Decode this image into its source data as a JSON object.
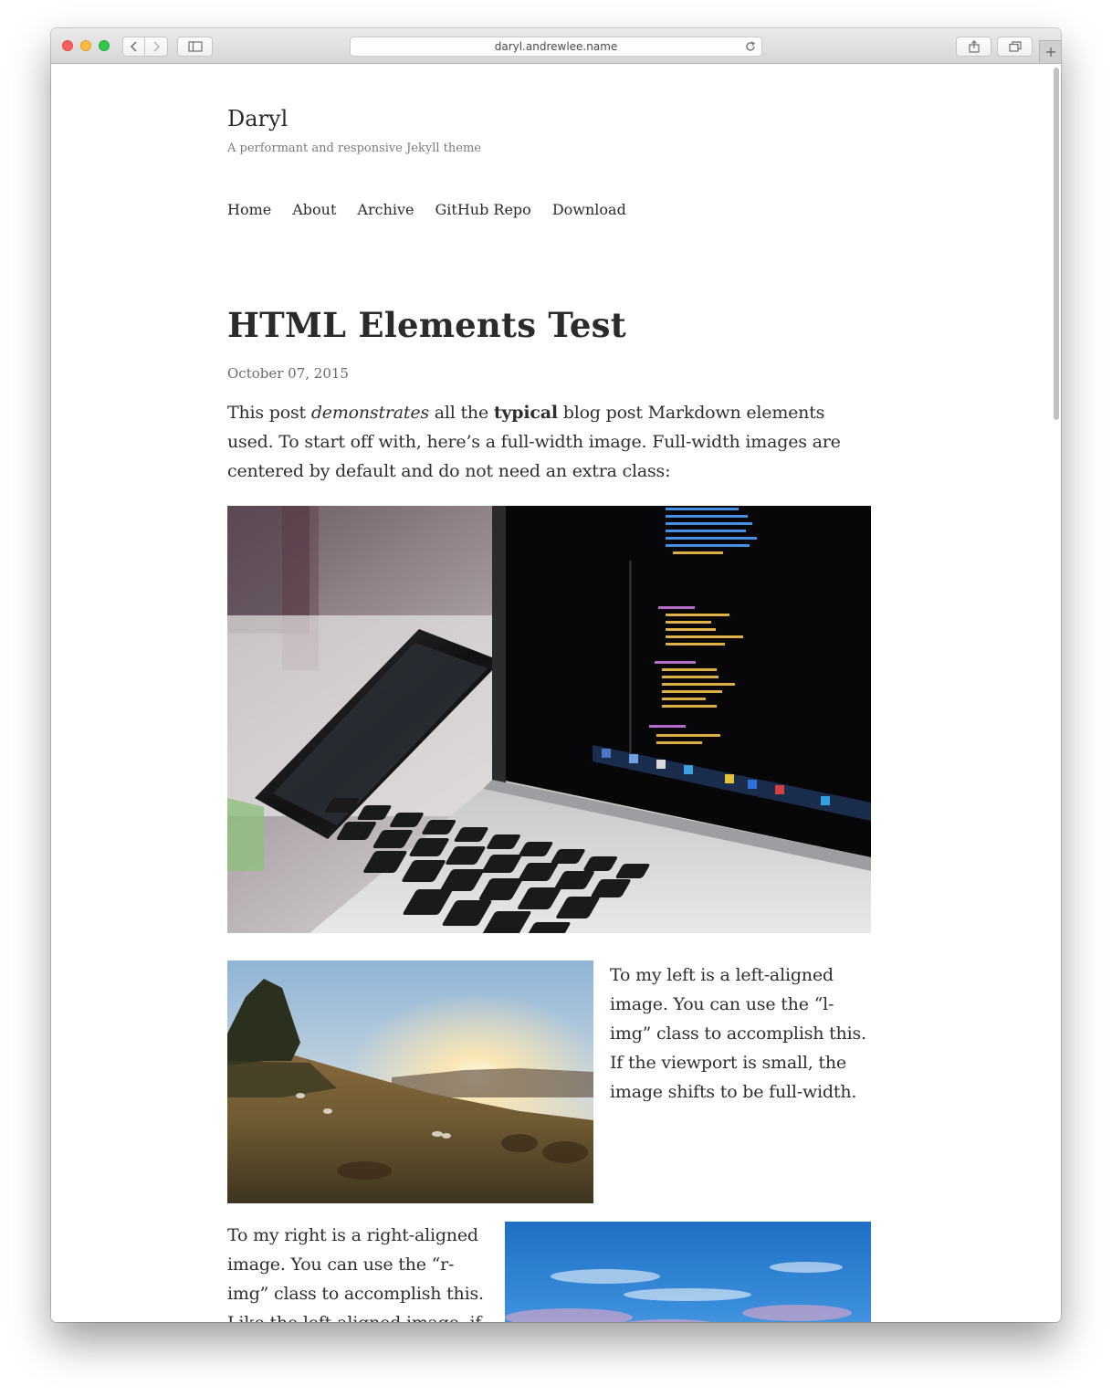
{
  "browser": {
    "url": "daryl.andrewlee.name"
  },
  "site": {
    "title": "Daryl",
    "tagline": "A performant and responsive Jekyll theme",
    "nav": [
      "Home",
      "About",
      "Archive",
      "GitHub Repo",
      "Download"
    ]
  },
  "post": {
    "title": "HTML Elements Test",
    "date": "October 07, 2015",
    "intro": {
      "before_em": "This post ",
      "em": "demonstrates",
      "between": " all the ",
      "strong": "typical",
      "after": " blog post Markdown elements used. To start off with, here’s a full-width image. Full-width images are centered by default and do not need an extra class:"
    },
    "left_text": "To my left is a left-aligned image. You can use the “l-img” class to accomplish this. If the viewport is small, the image shifts to be full-width.",
    "right_text": "To my right is a right-aligned image. You can use the “r-img” class to accomplish this. Like the left-aligned image, if the viewport is small, the image shifts to be full-width."
  },
  "colors": {
    "text": "#313131",
    "muted": "#7a7a7a",
    "toolbar": "#dcdcdc"
  },
  "icons": [
    "back-icon",
    "forward-icon",
    "sidebar-icon",
    "reload-icon",
    "share-icon",
    "tabs-icon",
    "plus-icon"
  ]
}
